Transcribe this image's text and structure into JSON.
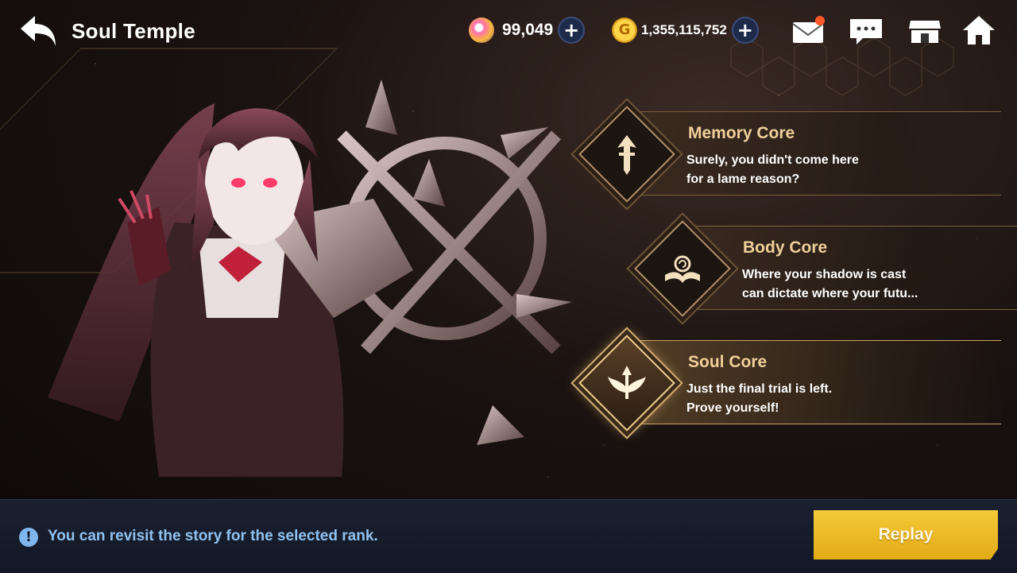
{
  "header": {
    "title": "Soul Temple",
    "gems": "99,049",
    "gold": "1,355,115,752"
  },
  "cores": [
    {
      "name": "Memory Core",
      "desc": "Surely, you didn't come here\nfor a lame reason?",
      "icon": "sword-icon",
      "selected": false
    },
    {
      "name": "Body Core",
      "desc": "Where your shadow is cast\ncan dictate where your futu...",
      "icon": "book-icon",
      "selected": false
    },
    {
      "name": "Soul Core",
      "desc": "Just the final trial is left.\nProve yourself!",
      "icon": "wings-icon",
      "selected": true
    }
  ],
  "footer": {
    "notice": "You can revisit the story for the selected rank.",
    "replay_label": "Replay"
  },
  "colors": {
    "accent_gold": "#f0d09a",
    "replay_button": "#f5c938",
    "notice_text": "#8fc2f0"
  }
}
